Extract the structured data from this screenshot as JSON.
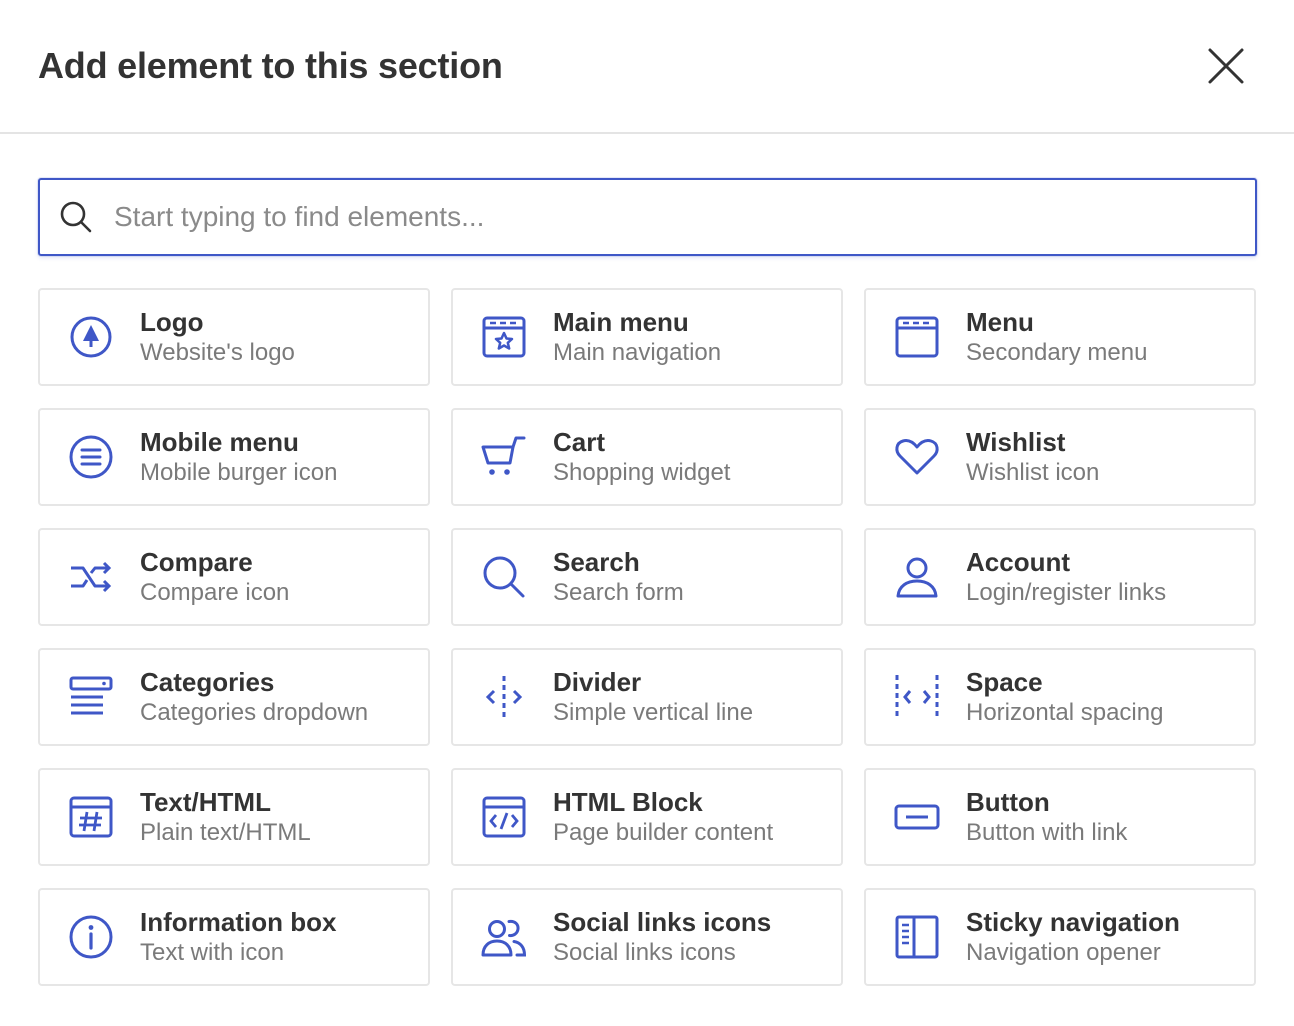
{
  "header": {
    "title": "Add element to this section"
  },
  "search": {
    "placeholder": "Start typing to find elements..."
  },
  "elements": [
    {
      "name": "Logo",
      "desc": "Website's logo",
      "icon": "logo-icon"
    },
    {
      "name": "Main menu",
      "desc": "Main navigation",
      "icon": "main-menu-icon"
    },
    {
      "name": "Menu",
      "desc": "Secondary menu",
      "icon": "menu-icon"
    },
    {
      "name": "Mobile menu",
      "desc": "Mobile burger icon",
      "icon": "mobile-menu-icon"
    },
    {
      "name": "Cart",
      "desc": "Shopping widget",
      "icon": "cart-icon"
    },
    {
      "name": "Wishlist",
      "desc": "Wishlist icon",
      "icon": "heart-icon"
    },
    {
      "name": "Compare",
      "desc": "Compare icon",
      "icon": "compare-icon"
    },
    {
      "name": "Search",
      "desc": "Search form",
      "icon": "search-icon"
    },
    {
      "name": "Account",
      "desc": "Login/register links",
      "icon": "account-icon"
    },
    {
      "name": "Categories",
      "desc": "Categories dropdown",
      "icon": "categories-icon"
    },
    {
      "name": "Divider",
      "desc": "Simple vertical line",
      "icon": "divider-icon"
    },
    {
      "name": "Space",
      "desc": "Horizontal spacing",
      "icon": "space-icon"
    },
    {
      "name": "Text/HTML",
      "desc": "Plain text/HTML",
      "icon": "text-html-icon"
    },
    {
      "name": "HTML Block",
      "desc": "Page builder content",
      "icon": "html-block-icon"
    },
    {
      "name": "Button",
      "desc": "Button with link",
      "icon": "button-icon"
    },
    {
      "name": "Information box",
      "desc": "Text with icon",
      "icon": "info-icon"
    },
    {
      "name": "Social links icons",
      "desc": "Social links icons",
      "icon": "social-icon"
    },
    {
      "name": "Sticky navigation",
      "desc": "Navigation opener",
      "icon": "sticky-nav-icon"
    }
  ],
  "colors": {
    "accent": "#3f57c7",
    "border": "#e6e6e6",
    "muted": "#7a7a7a"
  }
}
